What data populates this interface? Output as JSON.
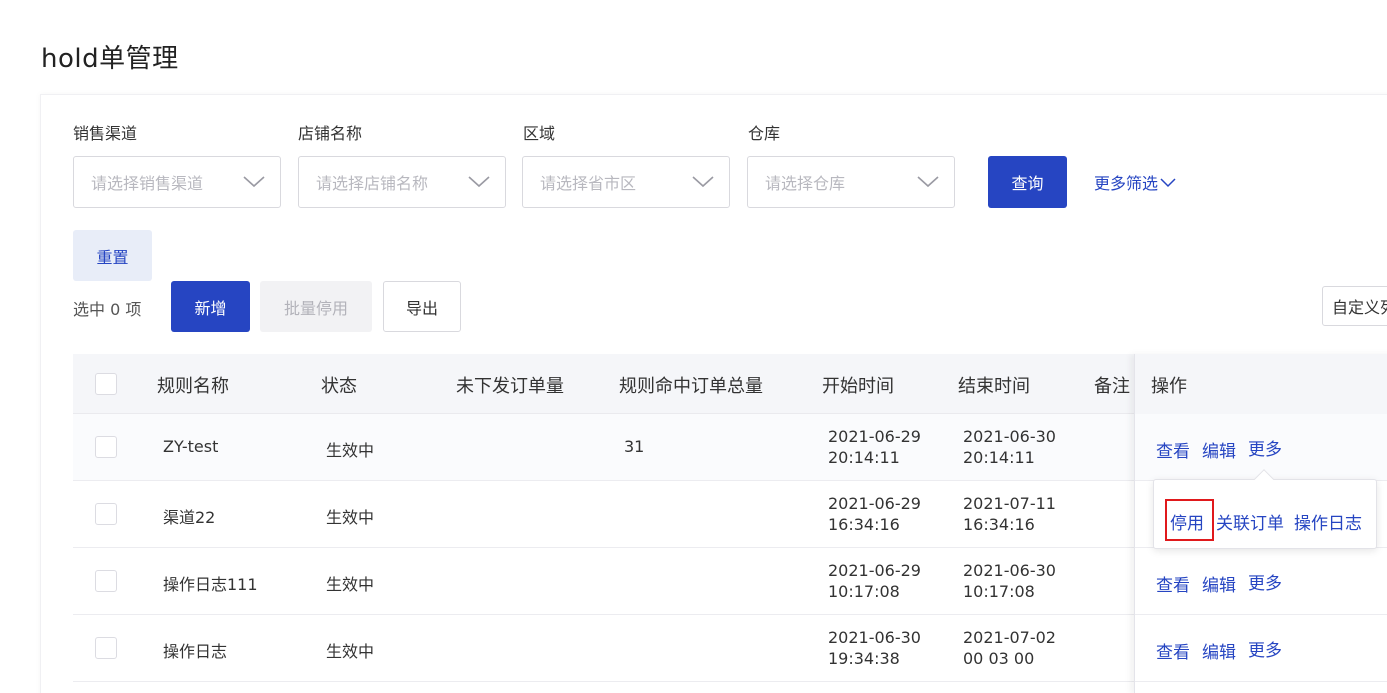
{
  "page": {
    "title": "hold单管理"
  },
  "filters": [
    {
      "label": "销售渠道",
      "placeholder": "请选择销售渠道"
    },
    {
      "label": "店铺名称",
      "placeholder": "请选择店铺名称"
    },
    {
      "label": "区域",
      "placeholder": "请选择省市区"
    },
    {
      "label": "仓库",
      "placeholder": "请选择仓库"
    }
  ],
  "actions": {
    "query": "查询",
    "more_filter": "更多筛选",
    "reset": "重置",
    "selected_count": "选中 0 项",
    "add": "新增",
    "batch_disable": "批量停用",
    "export": "导出",
    "custom_columns": "自定义列"
  },
  "table": {
    "headers": [
      "规则名称",
      "状态",
      "未下发订单量",
      "规则命中订单总量",
      "开始时间",
      "结束时间",
      "备注",
      "操作"
    ],
    "rows": [
      {
        "name": "ZY-test",
        "status": "生效中",
        "pending": "",
        "total": "31",
        "start_date": "2021-06-29",
        "start_time": "20:14:11",
        "end_date": "2021-06-30",
        "end_time": "20:14:11"
      },
      {
        "name": "渠道22",
        "status": "生效中",
        "pending": "",
        "total": "",
        "start_date": "2021-06-29",
        "start_time": "16:34:16",
        "end_date": "2021-07-11",
        "end_time": "16:34:16"
      },
      {
        "name": "操作日志111",
        "status": "生效中",
        "pending": "",
        "total": "",
        "start_date": "2021-06-29",
        "start_time": "10:17:08",
        "end_date": "2021-06-30",
        "end_time": "10:17:08"
      },
      {
        "name": "操作日志",
        "status": "生效中",
        "pending": "",
        "total": "",
        "start_date": "2021-06-30",
        "start_time": "19:34:38",
        "end_date": "2021-07-02",
        "end_time": "00 03 00"
      }
    ],
    "row_actions": {
      "view": "查看",
      "edit": "编辑",
      "more": "更多"
    }
  },
  "more_menu": {
    "disable": "停用",
    "related_orders": "关联订单",
    "operation_log": "操作日志"
  },
  "colors": {
    "primary": "#2645c2",
    "highlight": "#e0191c"
  }
}
